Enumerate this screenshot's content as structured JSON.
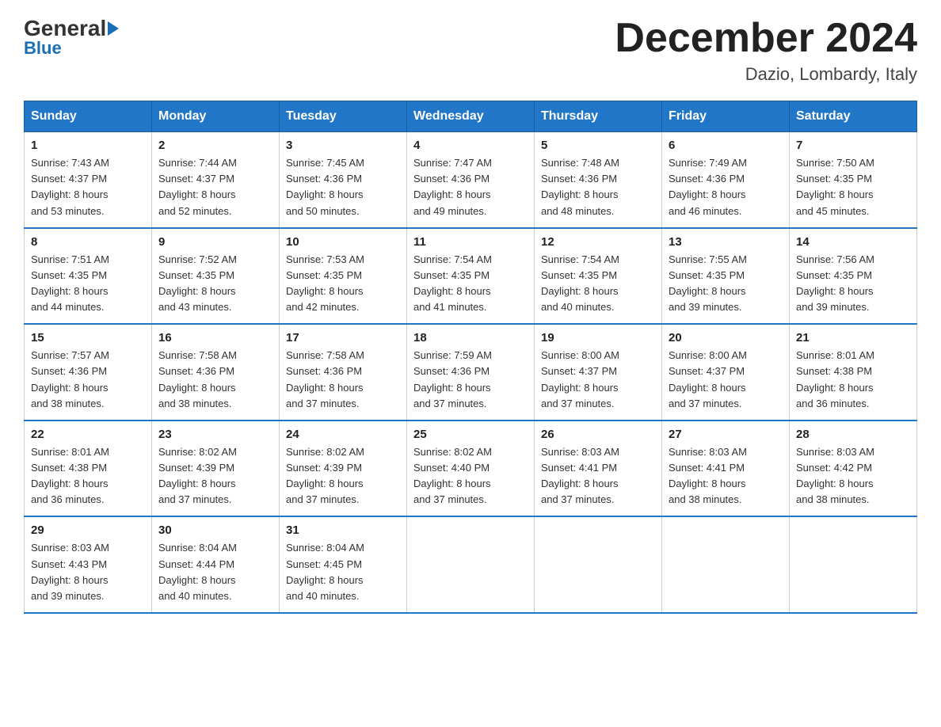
{
  "logo": {
    "general": "General",
    "blue": "Blue"
  },
  "title": "December 2024",
  "subtitle": "Dazio, Lombardy, Italy",
  "days_of_week": [
    "Sunday",
    "Monday",
    "Tuesday",
    "Wednesday",
    "Thursday",
    "Friday",
    "Saturday"
  ],
  "weeks": [
    [
      {
        "day": "1",
        "sunrise": "7:43 AM",
        "sunset": "4:37 PM",
        "daylight": "8 hours and 53 minutes."
      },
      {
        "day": "2",
        "sunrise": "7:44 AM",
        "sunset": "4:37 PM",
        "daylight": "8 hours and 52 minutes."
      },
      {
        "day": "3",
        "sunrise": "7:45 AM",
        "sunset": "4:36 PM",
        "daylight": "8 hours and 50 minutes."
      },
      {
        "day": "4",
        "sunrise": "7:47 AM",
        "sunset": "4:36 PM",
        "daylight": "8 hours and 49 minutes."
      },
      {
        "day": "5",
        "sunrise": "7:48 AM",
        "sunset": "4:36 PM",
        "daylight": "8 hours and 48 minutes."
      },
      {
        "day": "6",
        "sunrise": "7:49 AM",
        "sunset": "4:36 PM",
        "daylight": "8 hours and 46 minutes."
      },
      {
        "day": "7",
        "sunrise": "7:50 AM",
        "sunset": "4:35 PM",
        "daylight": "8 hours and 45 minutes."
      }
    ],
    [
      {
        "day": "8",
        "sunrise": "7:51 AM",
        "sunset": "4:35 PM",
        "daylight": "8 hours and 44 minutes."
      },
      {
        "day": "9",
        "sunrise": "7:52 AM",
        "sunset": "4:35 PM",
        "daylight": "8 hours and 43 minutes."
      },
      {
        "day": "10",
        "sunrise": "7:53 AM",
        "sunset": "4:35 PM",
        "daylight": "8 hours and 42 minutes."
      },
      {
        "day": "11",
        "sunrise": "7:54 AM",
        "sunset": "4:35 PM",
        "daylight": "8 hours and 41 minutes."
      },
      {
        "day": "12",
        "sunrise": "7:54 AM",
        "sunset": "4:35 PM",
        "daylight": "8 hours and 40 minutes."
      },
      {
        "day": "13",
        "sunrise": "7:55 AM",
        "sunset": "4:35 PM",
        "daylight": "8 hours and 39 minutes."
      },
      {
        "day": "14",
        "sunrise": "7:56 AM",
        "sunset": "4:35 PM",
        "daylight": "8 hours and 39 minutes."
      }
    ],
    [
      {
        "day": "15",
        "sunrise": "7:57 AM",
        "sunset": "4:36 PM",
        "daylight": "8 hours and 38 minutes."
      },
      {
        "day": "16",
        "sunrise": "7:58 AM",
        "sunset": "4:36 PM",
        "daylight": "8 hours and 38 minutes."
      },
      {
        "day": "17",
        "sunrise": "7:58 AM",
        "sunset": "4:36 PM",
        "daylight": "8 hours and 37 minutes."
      },
      {
        "day": "18",
        "sunrise": "7:59 AM",
        "sunset": "4:36 PM",
        "daylight": "8 hours and 37 minutes."
      },
      {
        "day": "19",
        "sunrise": "8:00 AM",
        "sunset": "4:37 PM",
        "daylight": "8 hours and 37 minutes."
      },
      {
        "day": "20",
        "sunrise": "8:00 AM",
        "sunset": "4:37 PM",
        "daylight": "8 hours and 37 minutes."
      },
      {
        "day": "21",
        "sunrise": "8:01 AM",
        "sunset": "4:38 PM",
        "daylight": "8 hours and 36 minutes."
      }
    ],
    [
      {
        "day": "22",
        "sunrise": "8:01 AM",
        "sunset": "4:38 PM",
        "daylight": "8 hours and 36 minutes."
      },
      {
        "day": "23",
        "sunrise": "8:02 AM",
        "sunset": "4:39 PM",
        "daylight": "8 hours and 37 minutes."
      },
      {
        "day": "24",
        "sunrise": "8:02 AM",
        "sunset": "4:39 PM",
        "daylight": "8 hours and 37 minutes."
      },
      {
        "day": "25",
        "sunrise": "8:02 AM",
        "sunset": "4:40 PM",
        "daylight": "8 hours and 37 minutes."
      },
      {
        "day": "26",
        "sunrise": "8:03 AM",
        "sunset": "4:41 PM",
        "daylight": "8 hours and 37 minutes."
      },
      {
        "day": "27",
        "sunrise": "8:03 AM",
        "sunset": "4:41 PM",
        "daylight": "8 hours and 38 minutes."
      },
      {
        "day": "28",
        "sunrise": "8:03 AM",
        "sunset": "4:42 PM",
        "daylight": "8 hours and 38 minutes."
      }
    ],
    [
      {
        "day": "29",
        "sunrise": "8:03 AM",
        "sunset": "4:43 PM",
        "daylight": "8 hours and 39 minutes."
      },
      {
        "day": "30",
        "sunrise": "8:04 AM",
        "sunset": "4:44 PM",
        "daylight": "8 hours and 40 minutes."
      },
      {
        "day": "31",
        "sunrise": "8:04 AM",
        "sunset": "4:45 PM",
        "daylight": "8 hours and 40 minutes."
      },
      null,
      null,
      null,
      null
    ]
  ],
  "labels": {
    "sunrise": "Sunrise:",
    "sunset": "Sunset:",
    "daylight": "Daylight:"
  }
}
